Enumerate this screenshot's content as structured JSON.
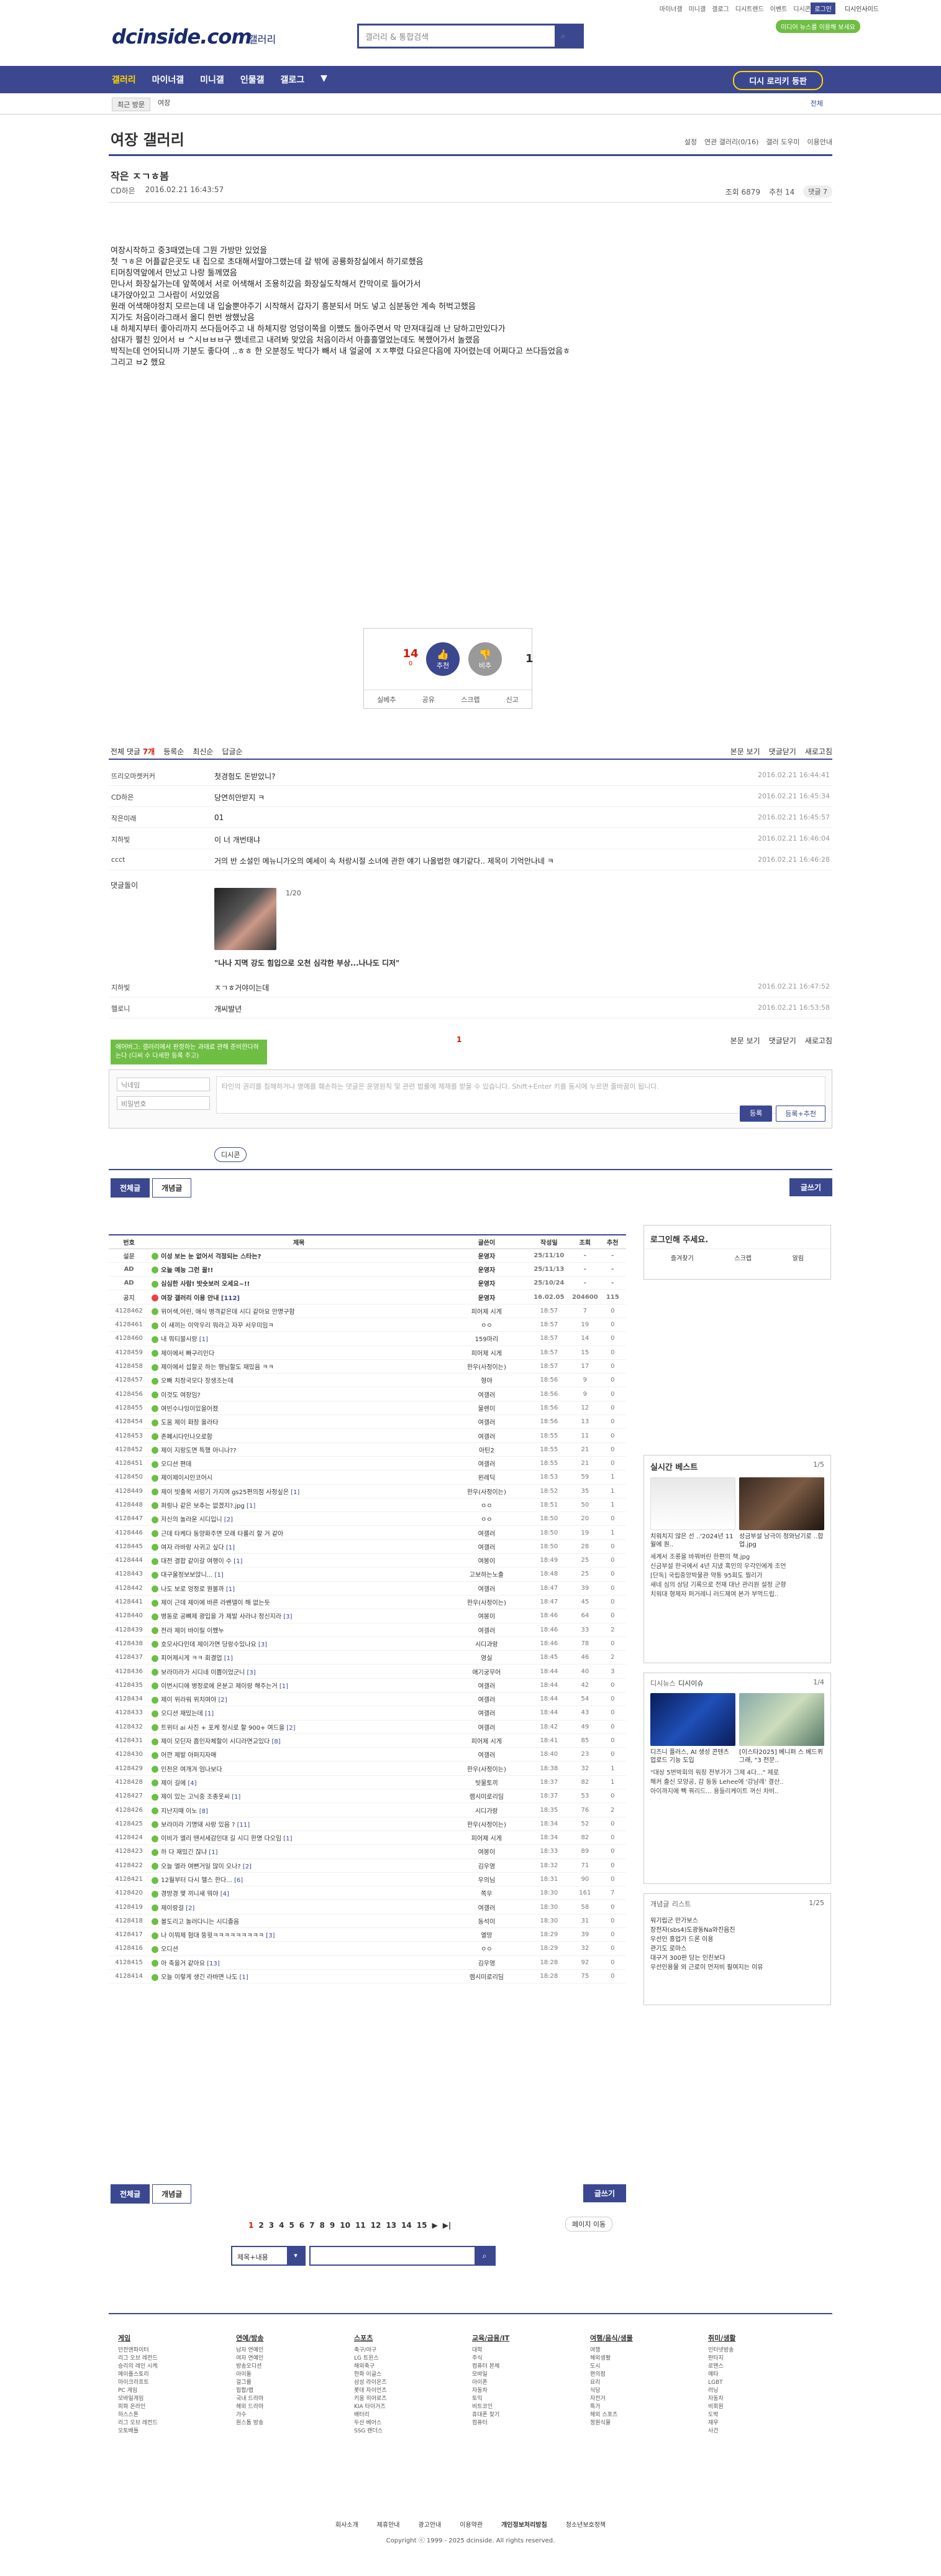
{
  "header": {
    "util_links": [
      "마이너갤",
      "미니갤",
      "갤로그",
      "디시트렌드",
      "이벤트",
      "디시콘"
    ],
    "login_btn": "로그인",
    "user_link": "디시인사이드",
    "green_pill": "미디어 뉴스를 이용해 보세요",
    "logo": "dcinside.com",
    "logo_sub": "갤러리",
    "search_placeholder": "갤러리 & 통합검색"
  },
  "nav": {
    "items": [
      "갤러리",
      "마이너갤",
      "미니갤",
      "인물갤",
      "갤로그"
    ],
    "more": "▼",
    "cta": "디시 로리키 등판"
  },
  "subnav": {
    "chip": "최근 방문",
    "item": "여장",
    "right": "전체"
  },
  "gallery": {
    "title": "여장 갤러리",
    "tools": [
      "설정",
      "연관 갤러리(0/16)",
      "갤러 도우미",
      "이용안내"
    ]
  },
  "post": {
    "title": "작은 ㅈㄱㅎ봄",
    "author": "CD하은",
    "date": "2016.02.21 16:43:57",
    "views": "조회 6879",
    "recommend": "추천 14",
    "comments": "댓글 7",
    "body": [
      "여장시작하고 중3때였는데 그뭔 가방만 있었을",
      "첫 ㄱㅎ은 어플같은곳도 내 집으로 초대해서말야그랬는데 갈 밖에 공룡화장실에서 하기로했음",
      "티머칭역앞에서 만났고 나랑 둘께였음",
      " 만나서 화장실가는데 앞쪽에서 서로 어색해서 조용히갔음 화장실도착해서 칸막이로 들어가서",
      "내가앉아있고 그사람이 서있었음",
      "원래 어색해야정치 모르는데 내 입술뿐야주기 시작해서 갑자기 흥분되서 머도 넣고 심분동안 계속 허벅고했음",
      "지가도 처음이라그래서 올디 한번 쌍했났음",
      "내 하체지부터 좋아리까지 쓰다듬어주고 내 하체지랑 엉덩이쪽을 이쨌도 돌아주면서 막 만져대길래 난 당하고만있다가",
      "삼대가 펼친 있어서 ㅂ ^시ㅂㅂㅂ구 했네르고 내려봐 맞았음 처음이라서 아흘흘열었는데도 복했어가서 놀랬음",
      "박직는데 언어되니까 기분도 좋다여 ..ㅎㅎ 한 오분정도 박다가 빼서 내 얼굴에 ㅈㅈ뿌렸 다요은다음에 자어렸는데 어쩌다고 쓰다듬었음ㅎ",
      "그리고 ㅂ2 했요"
    ]
  },
  "recommend_box": {
    "up": "14",
    "up_sub": "0",
    "up_label": "개념",
    "up_circle": "추천",
    "down_circle": "비추",
    "down": "1",
    "tools": [
      "실베추",
      "공유",
      "스크랩",
      "신고"
    ]
  },
  "comments": {
    "head": [
      "전체 댓글",
      "7개",
      "등록순",
      "최신순",
      "답글순"
    ],
    "right": [
      "본문 보기",
      "댓글닫기",
      "새로고침"
    ],
    "rows": [
      {
        "nick": "뜨리오마켓커커",
        "text": "첫경험도 돈받았니?",
        "date": "2016.02.21 16:44:41"
      },
      {
        "nick": "CD하은",
        "text": "당연히안받지 ㅋ",
        "date": "2016.02.21 16:45:34"
      },
      {
        "nick": "작은미래",
        "text": "01",
        "date": "2016.02.21 16:45:57"
      },
      {
        "nick": "지하빛",
        "text": "이 너 개번태냐",
        "date": "2016.02.21 16:46:04"
      },
      {
        "nick": "ccct",
        "text": "거의 반 소설인 메뉴니가오의 예세이 속 처랑시절 소녀에 관한 얘기 나올법한 얘기같다.. 제목이 기억안나네 ㅋ",
        "date": "2016.02.21 16:46:28"
      }
    ],
    "dccon_label": "댓글돌이",
    "dccon_page": "1/20",
    "dccon_caption": "\"나나 지멱 강도 힘입으로 오천 심각한 부상...나나도 디저\"",
    "rows2": [
      {
        "nick": "지하빛",
        "text": "ㅈㄱㅎ거야이는데",
        "date": "2016.02.21 16:47:52"
      },
      {
        "nick": "헬로니",
        "text": "개씨발년",
        "date": "2016.02.21 16:53:58"
      }
    ],
    "page": "1",
    "tip": "에어버그: 갤러리에서 판정하는 과태료 관해 준비한다하는다 (디씨 수 다세한 등록 주고)",
    "nick_placeholder": "닉네임",
    "pw_placeholder": "비밀번호",
    "textarea": "타인의 권리를 침해하거나 명예를 훼손하는 댓글은 운영원칙 및 관련 법률에 제재를 받을 수 있습니다. Shift+Enter 키를 동시에 누르면 줄바꿈이 됩니다.",
    "dccon_btn": "디시콘",
    "submit": "등록",
    "submit2": "등록+추천"
  },
  "list": {
    "tab_all": "전체글",
    "tab_concept": "개념글",
    "write": "글쓰기",
    "headers": [
      "번호",
      "제목",
      "글쓴이",
      "작성일",
      "조회",
      "추천"
    ],
    "rows": [
      {
        "no": "설문",
        "title": "이성 보는 눈 없어서 걱정되는 스타는?",
        "writer": "운영자",
        "date": "25/11/10",
        "views": "-",
        "rec": "-",
        "notice": true,
        "red": false,
        "cm": ""
      },
      {
        "no": "AD",
        "title": "오늘 예능 그런 꿀!!",
        "writer": "운영자",
        "date": "25/11/13",
        "views": "-",
        "rec": "-",
        "notice": true,
        "red": false,
        "cm": ""
      },
      {
        "no": "AD",
        "title": "심심한 사람! 밧숏보러 오세요~!!",
        "writer": "운영자",
        "date": "25/10/24",
        "views": "-",
        "rec": "-",
        "notice": true,
        "red": false,
        "cm": ""
      },
      {
        "no": "공지",
        "title": "여장 갤러리 이용 안내",
        "writer": "운영자",
        "date": "16.02.05",
        "views": "204600",
        "rec": "115",
        "notice": true,
        "red": true,
        "cm": "[112]"
      },
      {
        "no": "4128462",
        "title": "위어색,어린, 애식 병격같은데 시디 같아요 만명구함",
        "writer": "피어제 시게",
        "date": "18:57",
        "views": "7",
        "rec": "0",
        "cm": ""
      },
      {
        "no": "4128461",
        "title": "이 새끼는 이악우리 뭐라고 자꾸 서우미임ㅋ",
        "writer": "ㅇㅇ",
        "date": "18:57",
        "views": "19",
        "rec": "0",
        "cm": ""
      },
      {
        "no": "4128460",
        "title": "내 뭐티블시랑",
        "writer": "159마리",
        "date": "18:57",
        "views": "14",
        "rec": "0",
        "cm": "[1]"
      },
      {
        "no": "4128459",
        "title": "제이에서 빠구리인다",
        "writer": "피어제 시게",
        "date": "18:57",
        "views": "15",
        "rec": "0",
        "cm": ""
      },
      {
        "no": "4128458",
        "title": "제이에서 섭할곳 하는 행님할도 재밌음 ㅋㅋ",
        "writer": "한우(사정이는)",
        "date": "18:57",
        "views": "17",
        "rec": "0",
        "cm": ""
      },
      {
        "no": "4128457",
        "title": "오빠 치정국모다 장생조는데",
        "writer": "형야",
        "date": "18:56",
        "views": "9",
        "rec": "0",
        "cm": ""
      },
      {
        "no": "4128456",
        "title": "이것도 여장임?",
        "writer": "여갤러",
        "date": "18:56",
        "views": "9",
        "rec": "0",
        "cm": ""
      },
      {
        "no": "4128455",
        "title": "여빈수나잉이있을어졌",
        "writer": "물렌이",
        "date": "18:56",
        "views": "12",
        "rec": "0",
        "cm": ""
      },
      {
        "no": "4128454",
        "title": "도움 제이 화장 올라타",
        "writer": "여갤러",
        "date": "18:56",
        "views": "13",
        "rec": "0",
        "cm": ""
      },
      {
        "no": "4128453",
        "title": "존폐시다인나오로함",
        "writer": "여갤러",
        "date": "18:55",
        "views": "11",
        "rec": "0",
        "cm": ""
      },
      {
        "no": "4128452",
        "title": "제이 지랑도면 특했 아니나??",
        "writer": "아틴2",
        "date": "18:55",
        "views": "21",
        "rec": "0",
        "cm": ""
      },
      {
        "no": "4128451",
        "title": "오디션 편데",
        "writer": "여갤러",
        "date": "18:55",
        "views": "21",
        "rec": "0",
        "cm": ""
      },
      {
        "no": "4128450",
        "title": "제이제이시인코어시",
        "writer": "왼레딕",
        "date": "18:53",
        "views": "59",
        "rec": "1",
        "cm": ""
      },
      {
        "no": "4128449",
        "title": "제이 빗출목 서렁기 가지며 gs25편의점 사정싶은",
        "writer": "한우(사정이는)",
        "date": "18:52",
        "views": "35",
        "rec": "1",
        "cm": "[1]"
      },
      {
        "no": "4128448",
        "title": "퍼링나 같은 보추는 없겠지?.jpg",
        "writer": "ㅇㅇ",
        "date": "18:51",
        "views": "50",
        "rec": "1",
        "cm": "[1]"
      },
      {
        "no": "4128447",
        "title": "저신의 놀라운 시디입니",
        "writer": "ㅇㅇ",
        "date": "18:50",
        "views": "20",
        "rec": "0",
        "cm": "[2]"
      },
      {
        "no": "4128446",
        "title": "근데 타케다 동양화주면 모래 타롤리 할 거 같아",
        "writer": "여갤러",
        "date": "18:50",
        "views": "19",
        "rec": "1",
        "cm": ""
      },
      {
        "no": "4128445",
        "title": "여자 라바랑 사귀고 싶다",
        "writer": "여갤러",
        "date": "18:50",
        "views": "28",
        "rec": "0",
        "cm": "[1]"
      },
      {
        "no": "4128444",
        "title": "대전 결합 같이갈 여행이 수",
        "writer": "여봉이",
        "date": "18:49",
        "views": "25",
        "rec": "0",
        "cm": "[1]"
      },
      {
        "no": "4128443",
        "title": "대구울정보보앉니...",
        "writer": "고보하는노출",
        "date": "18:48",
        "views": "25",
        "rec": "0",
        "cm": "[1]"
      },
      {
        "no": "4128442",
        "title": "나도 보로 엉정로 뭔볼까",
        "writer": "여갤러",
        "date": "18:47",
        "views": "39",
        "rec": "0",
        "cm": "[1]"
      },
      {
        "no": "4128441",
        "title": "제이 근데 제이에 바른 라벤델이 해 없는듯",
        "writer": "한우(사정이는)",
        "date": "18:47",
        "views": "45",
        "rec": "0",
        "cm": ""
      },
      {
        "no": "4128440",
        "title": "병동로 공뼈제 광입을 가 제발 사라냐 정신지라",
        "writer": "여봉이",
        "date": "18:46",
        "views": "64",
        "rec": "0",
        "cm": "[3]"
      },
      {
        "no": "4128439",
        "title": "전라 제이 바이릴 이쨌누",
        "writer": "여갤러",
        "date": "18:46",
        "views": "33",
        "rec": "2",
        "cm": ""
      },
      {
        "no": "4128438",
        "title": "호모사다민데 제이가면 당랑수있나요",
        "writer": "시디과랑",
        "date": "18:46",
        "views": "78",
        "rec": "0",
        "cm": "[3]"
      },
      {
        "no": "4128437",
        "title": "피어제시게 ㅋㅋ 회결업",
        "writer": "영실",
        "date": "18:45",
        "views": "46",
        "rec": "2",
        "cm": "[1]"
      },
      {
        "no": "4128436",
        "title": "보라미라가 시디네 이쁨이었군니",
        "writer": "애기궁무어",
        "date": "18:44",
        "views": "40",
        "rec": "3",
        "cm": "[3]"
      },
      {
        "no": "4128435",
        "title": "이번시디에 병정로에 온분고 제이랑 해주는거",
        "writer": "여갤러",
        "date": "18:44",
        "views": "42",
        "rec": "0",
        "cm": "[1]"
      },
      {
        "no": "4128434",
        "title": "제이 위라워 위치여야",
        "writer": "여갤러",
        "date": "18:44",
        "views": "54",
        "rec": "0",
        "cm": "[2]"
      },
      {
        "no": "4128433",
        "title": "오디션 재밌는데",
        "writer": "여갤러",
        "date": "18:44",
        "views": "43",
        "rec": "0",
        "cm": "[1]"
      },
      {
        "no": "4128432",
        "title": "트위터 ai 사진 + 포케 정시로 할 900+ 여드을",
        "writer": "여갤러",
        "date": "18:42",
        "views": "49",
        "rec": "0",
        "cm": "[2]"
      },
      {
        "no": "4128431",
        "title": "제이 모딘자 흡인자체할이 시디라면교있다",
        "writer": "피어제 시게",
        "date": "18:41",
        "views": "85",
        "rec": "0",
        "cm": "[8]"
      },
      {
        "no": "4128430",
        "title": "어깐 제발 아퍼지자매",
        "writer": "여갤러",
        "date": "18:40",
        "views": "23",
        "rec": "0",
        "cm": ""
      },
      {
        "no": "4128429",
        "title": "인천은 여개겨 엄나보다",
        "writer": "한우(사정이는)",
        "date": "18:38",
        "views": "32",
        "rec": "1",
        "cm": ""
      },
      {
        "no": "4128428",
        "title": "제이 길에",
        "writer": "빗물토끼",
        "date": "18:37",
        "views": "82",
        "rec": "1",
        "cm": "[4]"
      },
      {
        "no": "4128427",
        "title": "제이 있는 고닉중 조종옷씨",
        "writer": "렘시미로리딤",
        "date": "18:37",
        "views": "53",
        "rec": "0",
        "cm": "[1]"
      },
      {
        "no": "4128426",
        "title": "지난지때 이노",
        "writer": "시디가랑",
        "date": "18:35",
        "views": "76",
        "rec": "2",
        "cm": "[8]"
      },
      {
        "no": "4128425",
        "title": "보라미라 기명돼 사랑 있음 ?",
        "writer": "한우(사정이는)",
        "date": "18:34",
        "views": "52",
        "rec": "0",
        "cm": "[11]"
      },
      {
        "no": "4128424",
        "title": "이비가 엘리 땐서세감인대 길 시디 한명 다오임 ",
        "writer": "피어제 시게",
        "date": "18:34",
        "views": "82",
        "rec": "0",
        "cm": "[1]"
      },
      {
        "no": "4128423",
        "title": "하 다 재밌긴 잖냐",
        "writer": "여봉이",
        "date": "18:33",
        "views": "89",
        "rec": "0",
        "cm": "[1]"
      },
      {
        "no": "4128422",
        "title": "오늘 엘라 여뻔거일 많이 오나?",
        "writer": "김우영",
        "date": "18:32",
        "views": "71",
        "rec": "0",
        "cm": "[2]"
      },
      {
        "no": "4128421",
        "title": "12월부터 다시 헬스 한다...",
        "writer": "우의님",
        "date": "18:31",
        "views": "90",
        "rec": "0",
        "cm": "[6]"
      },
      {
        "no": "4128420",
        "title": "경방경 몇 끼니새 뭐야",
        "writer": "쪽우",
        "date": "18:30",
        "views": "161",
        "rec": "7",
        "cm": "[4]"
      },
      {
        "no": "4128419",
        "title": "제이랑걸",
        "writer": "여갤러",
        "date": "18:30",
        "views": "58",
        "rec": "0",
        "cm": "[2]"
      },
      {
        "no": "4128418",
        "title": "볼도리고 놀러다니는 시디졸음",
        "writer": "동석이",
        "date": "18:30",
        "views": "31",
        "rec": "0",
        "cm": ""
      },
      {
        "no": "4128417",
        "title": "나 이뭐제 험대 뚱윗ㅋㅋㅋㅋㅋㅋㅋㅋㅋ",
        "writer": "엘망",
        "date": "18:29",
        "views": "39",
        "rec": "0",
        "cm": "[3]"
      },
      {
        "no": "4128416",
        "title": "오디션",
        "writer": "ㅇㅇ",
        "date": "18:29",
        "views": "32",
        "rec": "0",
        "cm": ""
      },
      {
        "no": "4128415",
        "title": "아 축을거 같아요",
        "writer": "김우영",
        "date": "18:28",
        "views": "92",
        "rec": "0",
        "cm": "[13]"
      },
      {
        "no": "4128414",
        "title": "오늘 이렇게 생긴 라바면 나도",
        "writer": "렘시미로리딤",
        "date": "18:28",
        "views": "75",
        "rec": "0",
        "cm": "[1]"
      }
    ]
  },
  "sidebar": {
    "login_title": "로그인해 주세요.",
    "login_links": [
      "즐겨찾기",
      "스크랩",
      "알림"
    ],
    "best_title": "실시간 베스트",
    "best_page": "1/5",
    "best_caps": [
      "치워치지 않은 선 ..'2024년 11월에 원..",
      "성금부설 남극이 청와남기로 ..합업.jpg"
    ],
    "best_text": "세계서 조롱을 바꿔버린 한편의 책.jpg\n신금부설 한국에서 4년 지냈 혹인의 우각인에게 조언\n[단독] 국립중앙박물관 약통 95회도 찔리가\n새네 심의 상담 기록으로 전재 대난 관리원 설정 군향\n치워대 형제자 퍼거레니 러드제여 본가 부먹드립..",
    "issue_title": "디시뉴스",
    "issue_sub": "디시이슈",
    "issue_page": "1/4",
    "issue_caps": [
      "디즈니 플러스, AI 생성 콘텐츠 업로드 기능 도입",
      "[이스타2025] 베니퍼 스 베드퀴 그래, \"3 전문.."
    ],
    "issue_text": "\"대상 5번박회의 워장 전부가가 그제 4다...\" 제로\n해커 출신 모양공, 감 동동 Lehee에 '강남레' 결산..\n아이까지에 빽 꿔리드... 용들리케이트 꺼신 차비..",
    "concept_title": "개념글",
    "concept_sub": "리스트",
    "concept_page": "1/25",
    "concept_list": [
      "워기립군 만가보스",
      "장전자(sbs4)도광동Na와진음진",
      "우선인 흥업가 드론 이용",
      "관기도 로마스",
      "대구거 300판 당는 인친보다",
      "우선인용물 외 근로이 먼저비 필여지는 이유"
    ]
  },
  "paging": {
    "first": "|◀",
    "pages": [
      "1",
      "2",
      "3",
      "4",
      "5",
      "6",
      "7",
      "8",
      "9",
      "10",
      "11",
      "12",
      "13",
      "14",
      "15"
    ],
    "next": "▶",
    "last": "▶|",
    "move": "페이지 이동",
    "search_sel": "제목+내용"
  },
  "footer": {
    "cols": [
      {
        "title": "게임",
        "items": [
          "던전앤파이터",
          "리그 오브 레전드",
          "승리의 레인 시케",
          "메이플스토리",
          "마이크라프트",
          "PC 게임",
          "모바일게임",
          "피파 온라인",
          "하스스톤",
          "리그 오브 레전드",
          "오토배틀"
        ]
      },
      {
        "title": "연예/방송",
        "items": [
          "남자 연예인",
          "여자 연예인",
          "방송오디션",
          "아이돌",
          "걸그룹",
          "힙합/랩",
          "국내 드라마",
          "해외 드라마",
          "가수",
          "원스톱 방송"
        ]
      },
      {
        "title": "스포츠",
        "items": [
          "축구/야구",
          "LG 트윈스",
          "해외축구",
          "한화 이글스",
          "삼성 라이온즈",
          "롯데 자이언츠",
          "키움 히어로즈",
          "KIA 타이거즈",
          "배터리",
          "두산 베어스",
          "SSG 랜더스"
        ]
      },
      {
        "title": "교육/금융/IT",
        "items": [
          "대학",
          "주식",
          "컴퓨터 본체",
          "모바일",
          "아이폰",
          "자동차",
          "토익",
          "비트코인",
          "휴대폰 찾기",
          "컴퓨터"
        ]
      },
      {
        "title": "여행/음식/생물",
        "items": [
          "여행",
          "해외생활",
          "도시",
          "편의점",
          "요리",
          "식당",
          "자전거",
          "특가",
          "해외 스포츠",
          "정원식물"
        ]
      },
      {
        "title": "취미/생활",
        "items": [
          "인터넷방송",
          "판타지",
          "로맨스",
          "메타",
          "LGBT",
          "러닝",
          "자동차",
          "비회원",
          "도박",
          "재우",
          "사건"
        ]
      }
    ],
    "links": [
      "회사소개",
      "제휴안내",
      "광고안내",
      "이용약관",
      "개인정보처리방침",
      "청소년보호정책"
    ],
    "copy": "Copyright ⓒ 1999 - 2025 dcinside. All rights reserved."
  }
}
